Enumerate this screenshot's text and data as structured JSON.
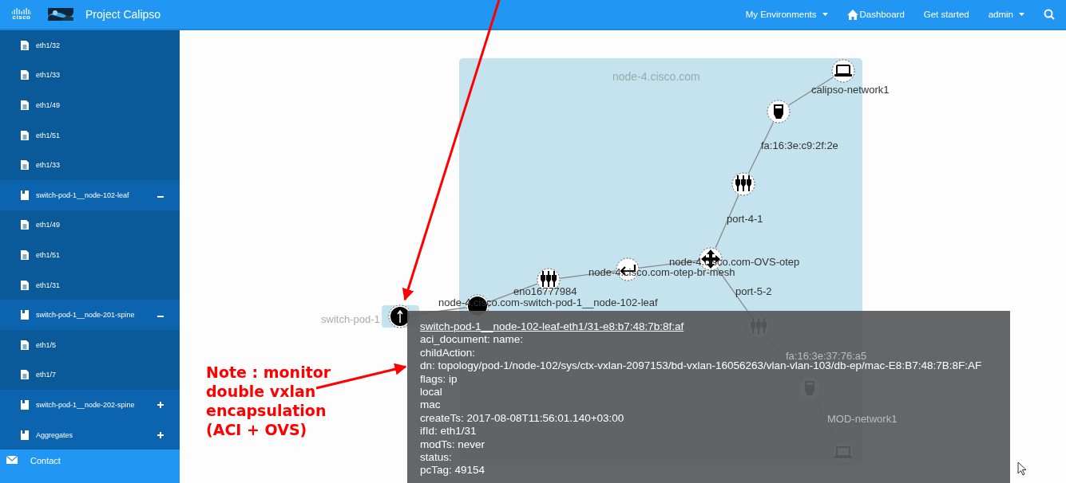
{
  "header": {
    "logo_text": "cisco",
    "title": "Project Calipso",
    "nav": [
      {
        "label": "My Environments",
        "kind": "dropdown"
      },
      {
        "label": "Dashboard",
        "kind": "home"
      },
      {
        "label": "Get started",
        "kind": "link"
      },
      {
        "label": "admin",
        "kind": "dropdown"
      }
    ]
  },
  "sidebar": {
    "items": [
      {
        "label": "eth1/32",
        "kind": "leaf"
      },
      {
        "label": "eth1/33",
        "kind": "leaf"
      },
      {
        "label": "eth1/49",
        "kind": "leaf"
      },
      {
        "label": "eth1/51",
        "kind": "leaf"
      },
      {
        "label": "eth1/33",
        "kind": "leaf"
      },
      {
        "label": "switch-pod-1__node-102-leaf",
        "kind": "group",
        "expanded": true,
        "children": [
          {
            "label": "eth1/49",
            "kind": "leaf"
          },
          {
            "label": "eth1/51",
            "kind": "leaf"
          },
          {
            "label": "eth1/31",
            "kind": "leaf"
          }
        ]
      },
      {
        "label": "switch-pod-1__node-201-spine",
        "kind": "group",
        "expanded": true,
        "children": [
          {
            "label": "eth1/5",
            "kind": "leaf"
          },
          {
            "label": "eth1/7",
            "kind": "leaf"
          }
        ]
      },
      {
        "label": "switch-pod-1__node-202-spine",
        "kind": "group",
        "expanded": false
      },
      {
        "label": "Aggregates",
        "kind": "group",
        "expanded": false
      }
    ],
    "footer": "Contact"
  },
  "graph": {
    "host": "node-4.cisco.com",
    "nodes": [
      {
        "kind": "laptop",
        "label": "calipso-network1"
      },
      {
        "kind": "plug",
        "label": "fa:16:3e:c9:2f:2e"
      },
      {
        "kind": "port",
        "label": "port-4-1"
      },
      {
        "kind": "cross",
        "label": "node-4.cisco.com-OVS-otep"
      },
      {
        "kind": "return",
        "label": "node-4.cisco.com-otep-br-mesh"
      },
      {
        "kind": "port",
        "label": "eno16777984"
      },
      {
        "kind": "switch",
        "label": "node-4.cisco.com-switch-pod-1__node-102-leaf"
      },
      {
        "kind": "uplink",
        "label": "switch-pod-1"
      },
      {
        "kind": "port",
        "label": "port-5-2"
      },
      {
        "kind": "plug",
        "label": "fa:16:3e:37:76:a5"
      },
      {
        "kind": "laptop",
        "label": "MOD-network1"
      }
    ]
  },
  "tooltip": {
    "title": "switch-pod-1__node-102-leaf-eth1/31-e8:b7:48:7b:8f:af",
    "lines": [
      "aci_document: name:",
      "childAction:",
      "dn: topology/pod-1/node-102/sys/ctx-vxlan-2097153/bd-vxlan-16056263/vlan-vlan-103/db-ep/mac-E8:B7:48:7B:8F:AF",
      "flags: ip",
      "local",
      "mac",
      "createTs: 2017-08-08T11:56:01.140+03:00",
      "ifId: eth1/31",
      "modTs: never",
      "status:",
      "pcTag: 49154"
    ]
  },
  "note": "Note : monitor\ndouble vxlan\nencapsulation\n(ACI + OVS)"
}
